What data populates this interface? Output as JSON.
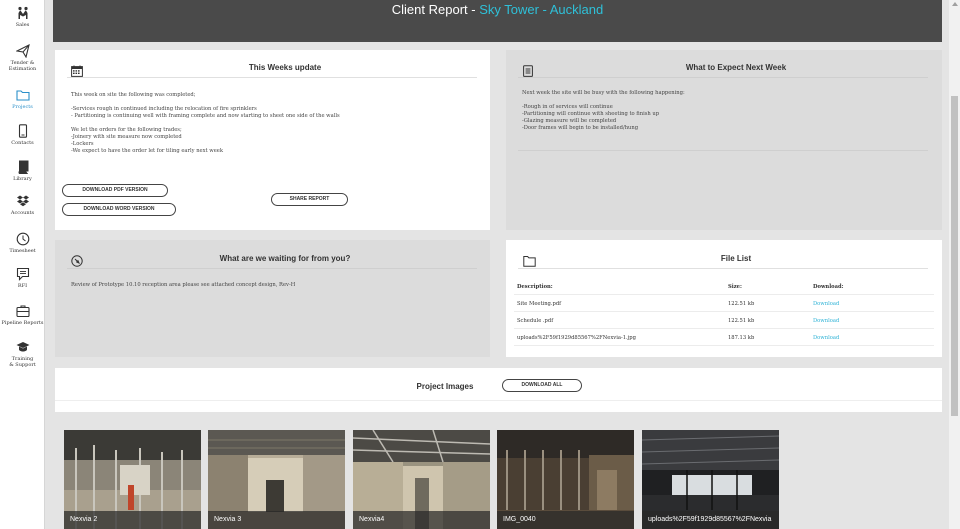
{
  "sidebar": {
    "items": [
      {
        "label": "Sales",
        "icon": "handshake-icon"
      },
      {
        "label": "Tender &\nEstimation",
        "icon": "paper-plane-icon"
      },
      {
        "label": "Projects",
        "icon": "folder-icon"
      },
      {
        "label": "Contacts",
        "icon": "phone-icon"
      },
      {
        "label": "Library",
        "icon": "book-icon"
      },
      {
        "label": "Accounts",
        "icon": "dropbox-icon"
      },
      {
        "label": "Timesheet",
        "icon": "clock-icon"
      },
      {
        "label": "RFI",
        "icon": "message-icon"
      },
      {
        "label": "Pipeline Reports",
        "icon": "briefcase-icon"
      },
      {
        "label": "Training\n& Support",
        "icon": "graduation-cap-icon"
      }
    ],
    "active_index": 2,
    "accent": "#2a8fc9"
  },
  "header": {
    "prefix": "Client Report - ",
    "project": "Sky Tower - Auckland",
    "background": "#4a4a4a",
    "accent": "#2fc0d8"
  },
  "weekly_update": {
    "title": "This Weeks update",
    "icon": "calendar-icon",
    "body": "This week on site the following was completed;\n\n-Services rough in continued including the relocation of fire sprinklers\n- Partitioning is continuing well with framing complete and now starting to sheet one side of the walls\n\nWe let the orders for the following trades;\n-Joinery with site measure now completed\n-Lockers\n-We expect to have the order let for tiling early next week",
    "download_pdf": "DOWNLOAD PDF VERSION",
    "download_word": "DOWNLOAD WORD VERSION",
    "share": "SHARE REPORT"
  },
  "next_week": {
    "title": "What to Expect Next Week",
    "icon": "list-icon",
    "body": "Next week the site will be busy with the following happening:\n\n-Rough in of services will continue\n-Partitioning will continue with sheeting to finish up\n-Glazing measure will be completed\n-Door frames will begin to be installed/hung"
  },
  "waiting": {
    "title": "What are we waiting for from you?",
    "icon": "compass-icon",
    "body": "Review of Prototype 10.10 reception area please see attached concept design, Rev-H"
  },
  "file_list": {
    "title": "File List",
    "icon": "folder-icon",
    "headers": {
      "description": "Description:",
      "size": "Size:",
      "download": "Download:"
    },
    "rows": [
      {
        "description": "Site Meeting.pdf",
        "size": "122.51 kb",
        "download": "Download"
      },
      {
        "description": "Schedule .pdf",
        "size": "122.51 kb",
        "download": "Download"
      },
      {
        "description": "uploads%2F59f1929d85567%2FNexvia-1.jpg",
        "size": "187.13 kb",
        "download": "Download"
      }
    ],
    "link_color": "#2fb3d6"
  },
  "project_images": {
    "title": "Project Images",
    "download_all": "DOWNLOAD ALL",
    "images": [
      {
        "caption": "Nexvia 2"
      },
      {
        "caption": "Nexvia 3"
      },
      {
        "caption": "Nexvia4"
      },
      {
        "caption": "IMG_0040"
      },
      {
        "caption": "uploads%2F59f1929d85567%2FNexvia"
      }
    ]
  }
}
